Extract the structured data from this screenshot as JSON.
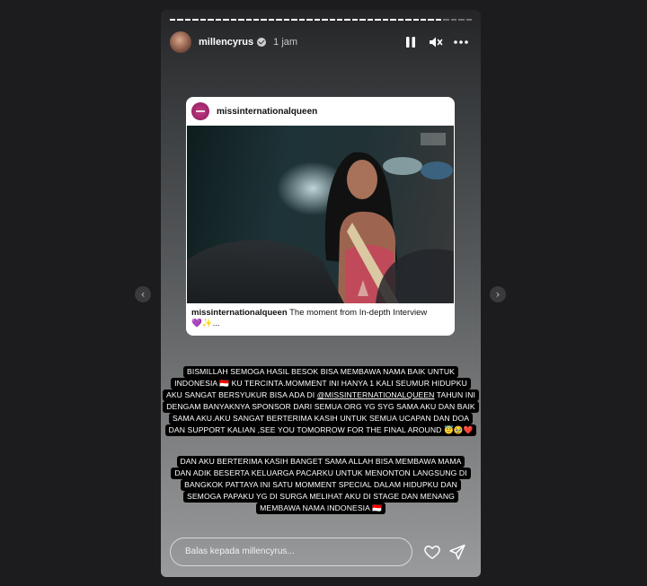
{
  "story": {
    "username": "millencyrus",
    "time_ago": "1 jam",
    "progress_segments": 40,
    "progress_done": 36,
    "reply_placeholder": "Balas kepada millencyrus..."
  },
  "post": {
    "account": "missinternationalqueen",
    "caption_user": "missinternationalqueen",
    "caption_text": "The moment from In-depth Interview",
    "caption_more": "💜✨..."
  },
  "stickers": {
    "first": [
      "BISMILLAH SEMOGA HASIL BESOK BISA MEMBAWA NAMA BAIK UNTUK",
      "INDONESIA 🇮🇩 KU TERCINTA.MOMMENT INI HANYA 1 KALI SEUMUR HIDUPKU",
      "AKU SANGAT BERSYUKUR BISA ADA DI ",
      "@MISSINTERNATIONALQUEEN",
      " TAHUN INI",
      "DENGAM BANYAKNYA SPONSOR DARI SEMUA ORG YG SYG SAMA AKU DAN BAIK",
      "SAMA AKU.AKU SANGAT BERTERIMA KASIH UNTUK SEMUA UCAPAN DAN DOA",
      "DAN SUPPORT KALIAN ,SEE YOU TOMORROW FOR THE FINAL AROUND 😇🥹❤️"
    ],
    "second": [
      "DAN  AKU BERTERIMA KASIH BANGET SAMA ALLAH BISA MEMBAWA MAMA",
      "DAN ADIK BESERTA KELUARGA PACARKU UNTUK MENONTON LANGSUNG DI",
      "BANGKOK PATTAYA INI SATU MOMMENT SPECIAL DALAM HIDUPKU DAN",
      "SEMOGA PAPAKU YG DI SURGA MELIHAT AKU DI STAGE DAN MENANG",
      "MEMBAWA NAMA INDONESIA 🇮🇩"
    ]
  },
  "icons": {
    "prev": "chevron-left-icon",
    "next": "chevron-right-icon",
    "pause": "pause-icon",
    "mute": "speaker-muted-icon",
    "more": "more-dots-icon",
    "like": "heart-icon",
    "send": "send-icon"
  },
  "colors": {
    "page_bg": "#1c1c1e",
    "sticker_bg": "#000000",
    "sticker_text": "#ffffff"
  }
}
